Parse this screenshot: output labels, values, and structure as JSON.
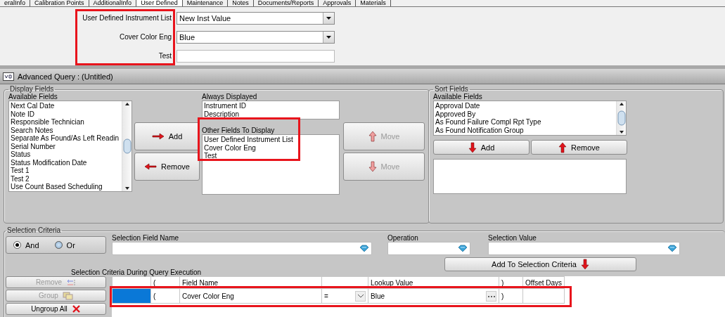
{
  "tabs": [
    {
      "label": "eralInfo",
      "selected": false
    },
    {
      "label": "Calibration Points",
      "selected": false
    },
    {
      "label": "AdditionalInfo",
      "selected": false
    },
    {
      "label": "User Defined",
      "selected": true
    },
    {
      "label": "Maintenance",
      "selected": false
    },
    {
      "label": "Notes",
      "selected": false
    },
    {
      "label": "Documents/Reports",
      "selected": false
    },
    {
      "label": "Approvals",
      "selected": false
    },
    {
      "label": "Materials",
      "selected": false
    }
  ],
  "user_defined": {
    "fields": [
      {
        "label": "User Defined Instrument List",
        "kind": "dropdown",
        "value": "New Inst Value"
      },
      {
        "label": "Cover Color Eng",
        "kind": "dropdown",
        "value": "Blue"
      },
      {
        "label": "Test",
        "kind": "text"
      }
    ]
  },
  "query": {
    "title": "Advanced Query : (Untitled)",
    "display_fields": {
      "legend": "Display Fields",
      "available_label": "Available Fields",
      "available": [
        "Next Cal Date",
        "Note ID",
        "Responsible Technician",
        "Search Notes",
        "Separate As Found/As Left Readin",
        "Serial Number",
        "Status",
        "Status Modification Date",
        "Test 1",
        "Test 2",
        "Use Count Based Scheduling"
      ],
      "add_button": "Add",
      "remove_button": "Remove",
      "always_label": "Always Displayed",
      "always": [
        "Instrument ID",
        "Description"
      ],
      "other_label": "Other Fields To Display",
      "other": [
        "User Defined Instrument List",
        "Cover Color Eng",
        "Test"
      ],
      "move_buttons": [
        {
          "label": "Move",
          "kind": "up",
          "disabled": true
        },
        {
          "label": "Move",
          "kind": "down",
          "disabled": true
        }
      ]
    },
    "sort_fields": {
      "legend": "Sort Fields",
      "available_label": "Available Fields",
      "available": [
        "Approval Date",
        "Approved By",
        "As Found Failure Compl Rpt Type",
        "As Found Notification Group"
      ],
      "add_button": "Add",
      "remove_button": "Remove"
    },
    "selection_criteria": {
      "legend": "Selection Criteria",
      "logic": [
        {
          "label": "And",
          "selected": true
        },
        {
          "label": "Or",
          "selected": false
        }
      ],
      "inputs": [
        {
          "label": "Selection Field Name"
        },
        {
          "label": "Operation"
        },
        {
          "label": "Selection Value"
        }
      ],
      "add_button": "Add To Selection Criteria",
      "grid_label": "Selection Criteria During Query Execution",
      "actions": [
        {
          "label": "Remove",
          "kind": "remove",
          "disabled": true
        },
        {
          "label": "Group",
          "kind": "group",
          "disabled": true
        },
        {
          "label": "Ungroup All",
          "kind": "ungroup",
          "disabled": false
        }
      ],
      "header": {
        "open_paren": "(",
        "field_name": "Field Name",
        "lookup_value": "Lookup Value",
        "close_paren": ")",
        "offset_days": "Offset Days"
      },
      "rows": [
        {
          "selected": true,
          "open_paren": "(",
          "field_name": "Cover Color Eng",
          "operator": "=",
          "lookup_value": "Blue",
          "close_paren": ")"
        }
      ]
    }
  }
}
